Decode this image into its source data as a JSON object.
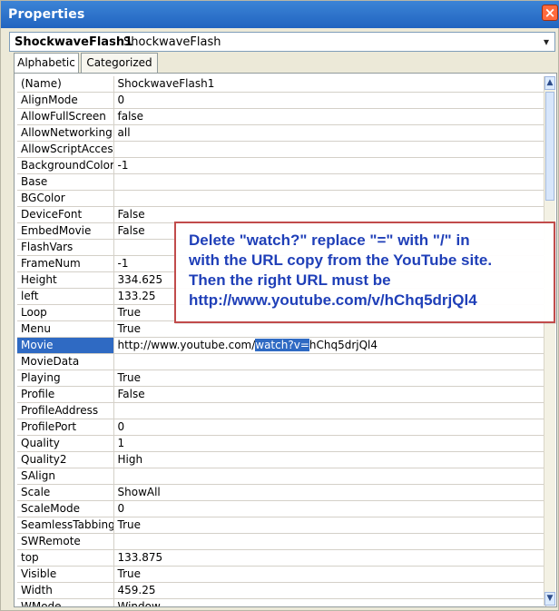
{
  "window": {
    "title": "Properties",
    "close_glyph": "×"
  },
  "object_selector": {
    "name": "ShockwaveFlash1",
    "type": "ShockwaveFlash",
    "dropdown_icon": "▾"
  },
  "tabs": [
    {
      "label": "Alphabetic",
      "active": true
    },
    {
      "label": "Categorized",
      "active": false
    }
  ],
  "properties": [
    {
      "name": "(Name)",
      "value": "ShockwaveFlash1"
    },
    {
      "name": "AlignMode",
      "value": "0"
    },
    {
      "name": "AllowFullScreen",
      "value": "false"
    },
    {
      "name": "AllowNetworking",
      "value": "all"
    },
    {
      "name": "AllowScriptAccess",
      "value": ""
    },
    {
      "name": "BackgroundColor",
      "value": "-1"
    },
    {
      "name": "Base",
      "value": ""
    },
    {
      "name": "BGColor",
      "value": ""
    },
    {
      "name": "DeviceFont",
      "value": "False"
    },
    {
      "name": "EmbedMovie",
      "value": "False"
    },
    {
      "name": "FlashVars",
      "value": ""
    },
    {
      "name": "FrameNum",
      "value": "-1"
    },
    {
      "name": "Height",
      "value": "334.625"
    },
    {
      "name": "left",
      "value": "133.25"
    },
    {
      "name": "Loop",
      "value": "True"
    },
    {
      "name": "Menu",
      "value": "True"
    },
    {
      "name": "Movie",
      "value_prefix": "http://www.youtube.com/",
      "value_highlight": "watch?v=",
      "value_suffix": "hChq5drjQl4",
      "selected": true
    },
    {
      "name": "MovieData",
      "value": ""
    },
    {
      "name": "Playing",
      "value": "True"
    },
    {
      "name": "Profile",
      "value": "False"
    },
    {
      "name": "ProfileAddress",
      "value": ""
    },
    {
      "name": "ProfilePort",
      "value": "0"
    },
    {
      "name": "Quality",
      "value": "1"
    },
    {
      "name": "Quality2",
      "value": "High"
    },
    {
      "name": "SAlign",
      "value": ""
    },
    {
      "name": "Scale",
      "value": "ShowAll"
    },
    {
      "name": "ScaleMode",
      "value": "0"
    },
    {
      "name": "SeamlessTabbing",
      "value": "True"
    },
    {
      "name": "SWRemote",
      "value": ""
    },
    {
      "name": "top",
      "value": "133.875"
    },
    {
      "name": "Visible",
      "value": "True"
    },
    {
      "name": "Width",
      "value": "459.25"
    },
    {
      "name": "WMode",
      "value": "Window"
    }
  ],
  "annotation": {
    "lines": [
      "Delete \"watch?\" replace \"=\" with \"/\" in",
      "with the URL copy from the YouTube site.",
      "Then the right URL must be",
      "http://www.youtube.com/v/hChq5drjQl4"
    ]
  },
  "scrollbar": {
    "up_icon": "▲",
    "down_icon": "▼"
  }
}
